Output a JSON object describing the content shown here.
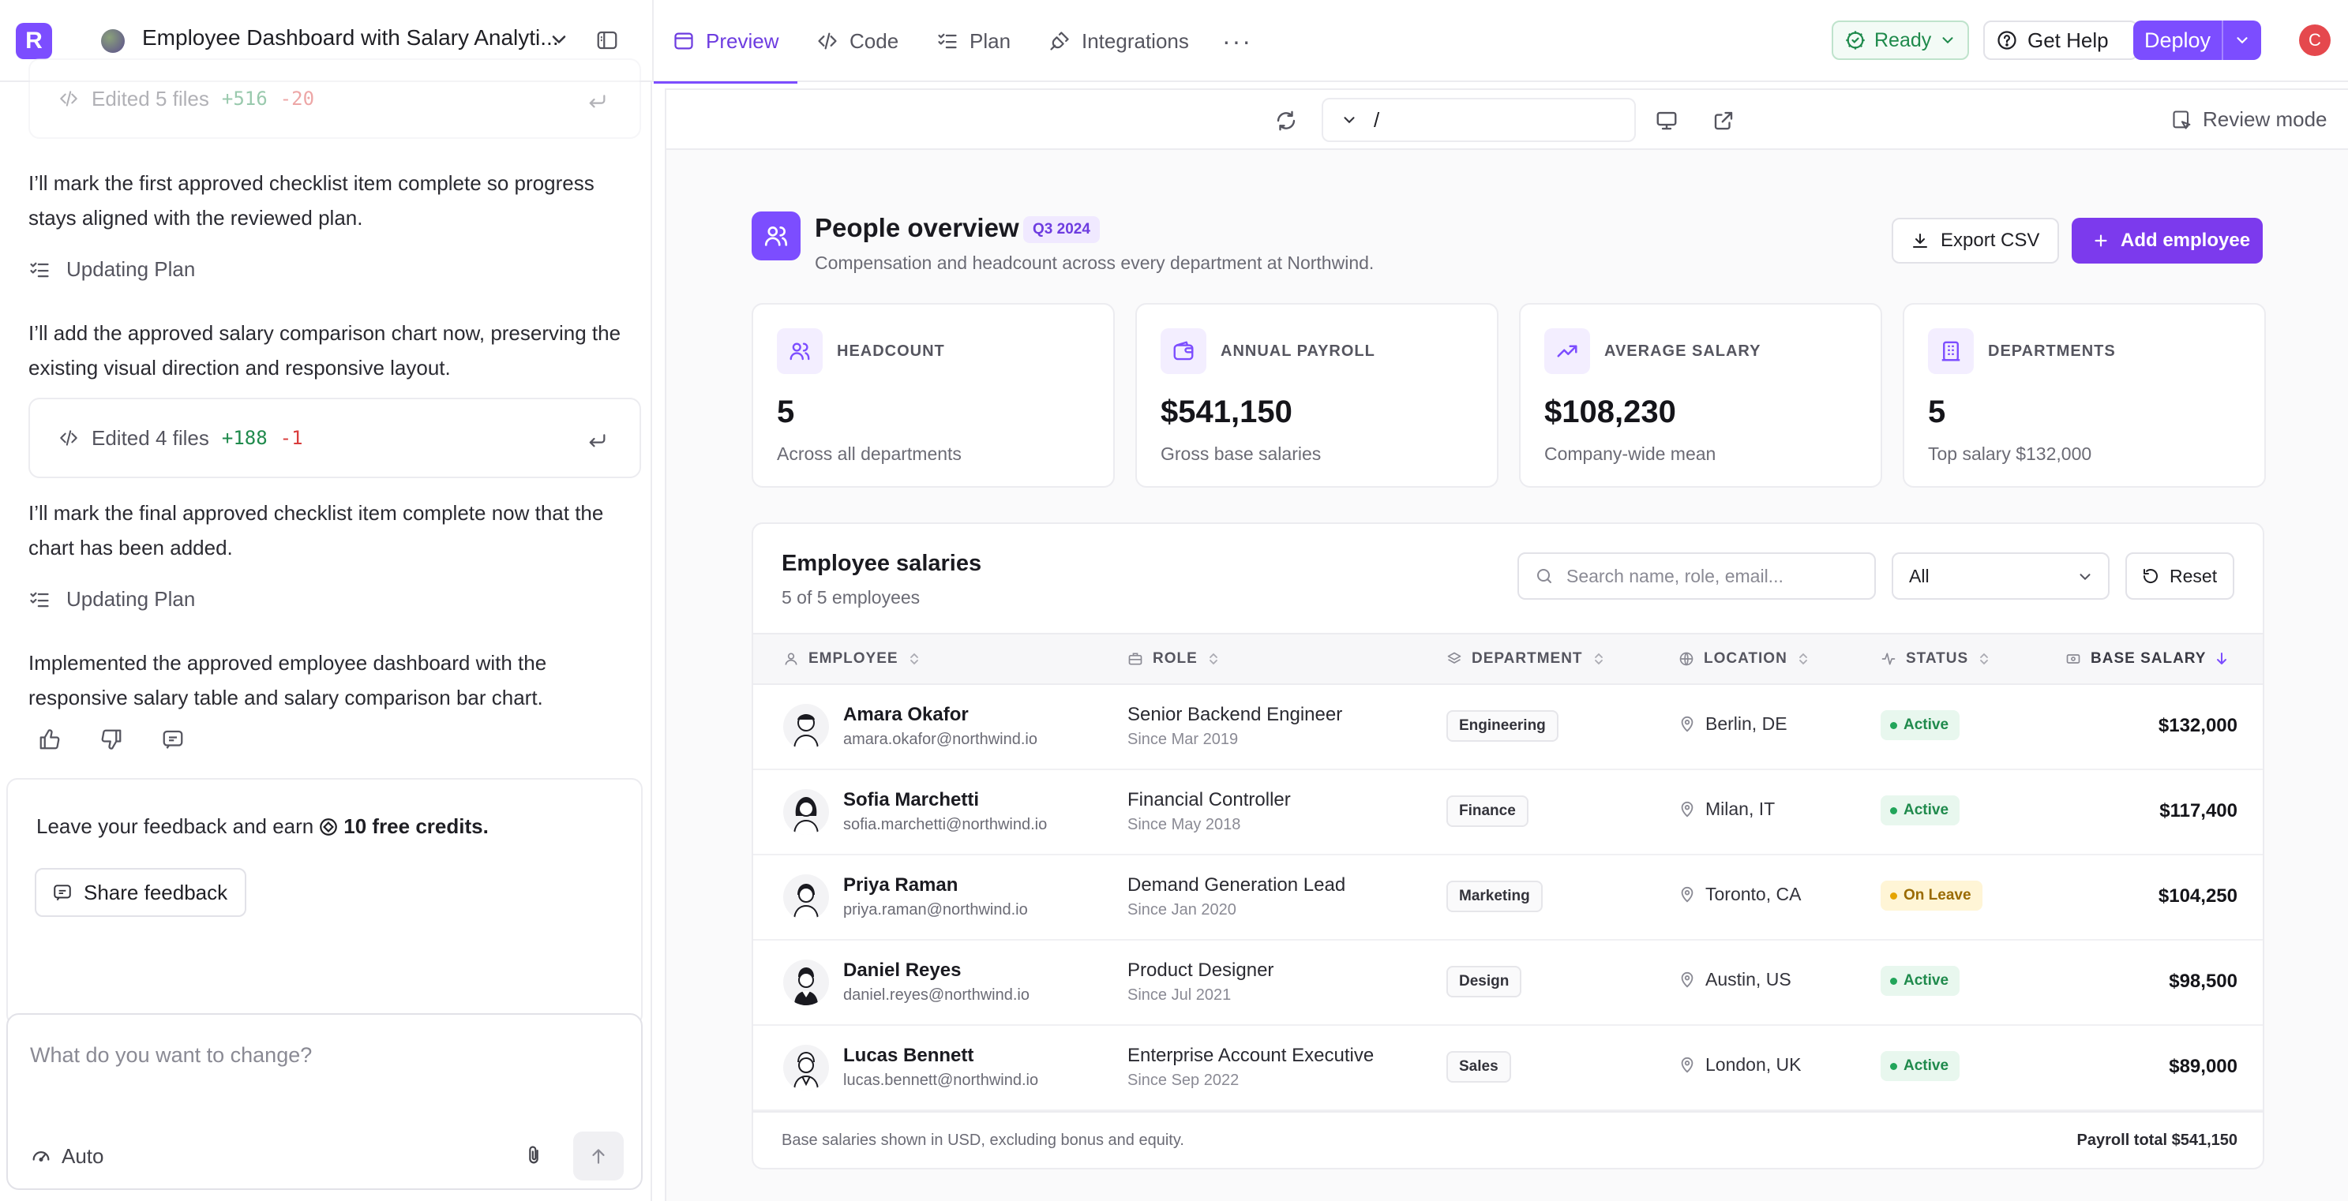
{
  "colors": {
    "accent": "#7c4dff",
    "primary_button": "#7c3aed",
    "status_active": "#22a55a",
    "status_leave": "#e5a400",
    "positive": "#1f8a4c",
    "negative": "#d93c3c"
  },
  "topbar": {
    "logo_letter": "R",
    "project_title": "Employee Dashboard with Salary Analyti...",
    "tabs": [
      {
        "label": "Preview",
        "icon": "browser-icon",
        "active": true
      },
      {
        "label": "Code",
        "icon": "code-icon",
        "active": false
      },
      {
        "label": "Plan",
        "icon": "checklist-icon",
        "active": false
      },
      {
        "label": "Integrations",
        "icon": "plug-icon",
        "active": false
      }
    ],
    "more_label": "···",
    "ready_label": "Ready",
    "help_label": "Get Help",
    "deploy_label": "Deploy",
    "user_initial": "C"
  },
  "chat": {
    "edit1": {
      "label": "Edited 5 files",
      "added": "+516",
      "removed": "-20"
    },
    "msg1": "I’ll mark the first approved checklist item complete so progress stays aligned with the reviewed plan.",
    "plan1": "Updating Plan",
    "msg2": "I’ll add the approved salary comparison chart now, preserving the existing visual direction and responsive layout.",
    "edit2": {
      "label": "Edited 4 files",
      "added": "+188",
      "removed": "-1"
    },
    "msg3": "I’ll mark the final approved checklist item complete now that the chart has been added.",
    "plan2": "Updating Plan",
    "msg4": "Implemented the approved employee dashboard with the responsive salary table and salary comparison bar chart.",
    "feedback_prefix": "Leave your feedback and earn",
    "feedback_credits": "10 free credits.",
    "share_label": "Share feedback",
    "composer_placeholder": "What do you want to change?",
    "mode_label": "Auto"
  },
  "preview": {
    "url_path": "/",
    "review_mode_label": "Review mode"
  },
  "page": {
    "title": "People overview",
    "period_badge": "Q3 2024",
    "subtitle": "Compensation and headcount across every department at Northwind.",
    "export_label": "Export CSV",
    "add_label": "Add employee"
  },
  "stats": [
    {
      "label": "HEADCOUNT",
      "value": "5",
      "sub": "Across all departments",
      "icon": "people-icon"
    },
    {
      "label": "ANNUAL PAYROLL",
      "value": "$541,150",
      "sub": "Gross base salaries",
      "icon": "wallet-icon"
    },
    {
      "label": "AVERAGE SALARY",
      "value": "$108,230",
      "sub": "Company-wide mean",
      "icon": "trend-up-icon"
    },
    {
      "label": "DEPARTMENTS",
      "value": "5",
      "sub": "Top salary $132,000",
      "icon": "building-icon"
    }
  ],
  "table": {
    "title": "Employee salaries",
    "count": "5 of 5 employees",
    "search_placeholder": "Search name, role, email...",
    "filter_value": "All",
    "reset_label": "Reset",
    "columns": {
      "employee": "EMPLOYEE",
      "role": "ROLE",
      "department": "DEPARTMENT",
      "location": "LOCATION",
      "status": "STATUS",
      "salary": "BASE SALARY"
    },
    "rows": [
      {
        "name": "Amara Okafor",
        "email": "amara.okafor@northwind.io",
        "role": "Senior Backend Engineer",
        "since": "Since Mar 2019",
        "department": "Engineering",
        "location": "Berlin, DE",
        "status": "Active",
        "salary": "$132,000"
      },
      {
        "name": "Sofia Marchetti",
        "email": "sofia.marchetti@northwind.io",
        "role": "Financial Controller",
        "since": "Since May 2018",
        "department": "Finance",
        "location": "Milan, IT",
        "status": "Active",
        "salary": "$117,400"
      },
      {
        "name": "Priya Raman",
        "email": "priya.raman@northwind.io",
        "role": "Demand Generation Lead",
        "since": "Since Jan 2020",
        "department": "Marketing",
        "location": "Toronto, CA",
        "status": "On Leave",
        "salary": "$104,250"
      },
      {
        "name": "Daniel Reyes",
        "email": "daniel.reyes@northwind.io",
        "role": "Product Designer",
        "since": "Since Jul 2021",
        "department": "Design",
        "location": "Austin, US",
        "status": "Active",
        "salary": "$98,500"
      },
      {
        "name": "Lucas Bennett",
        "email": "lucas.bennett@northwind.io",
        "role": "Enterprise Account Executive",
        "since": "Since Sep 2022",
        "department": "Sales",
        "location": "London, UK",
        "status": "Active",
        "salary": "$89,000"
      }
    ],
    "footer_note": "Base salaries shown in USD, excluding bonus and equity.",
    "footer_total": "Payroll total $541,150"
  }
}
